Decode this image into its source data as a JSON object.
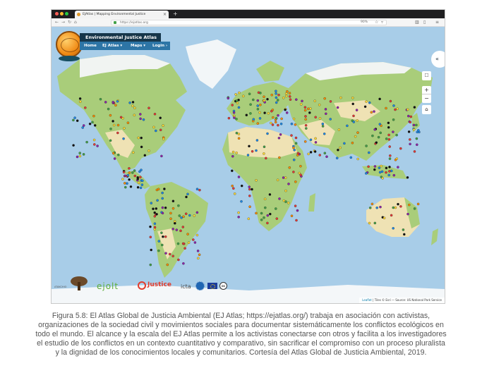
{
  "browser": {
    "tab_title": "EJAtlas | Mapping Environmental Justice",
    "tab_close": "×",
    "new_tab": "+",
    "url": "https://ejatlas.org",
    "zoom": "90%",
    "icons": [
      "back-arrow",
      "forward-arrow",
      "reload",
      "home",
      "lock",
      "star",
      "bookmark",
      "library",
      "sidebar",
      "menu"
    ]
  },
  "site": {
    "title": "Environmental Justice Atlas",
    "nav": [
      {
        "label": "Home"
      },
      {
        "label": "EJ Atlas ▾"
      },
      {
        "label": "Maps ▾"
      },
      {
        "label": "Login ›"
      }
    ]
  },
  "map": {
    "collapse_icon": "«",
    "layers_icon": "☐",
    "zoom_in": "+",
    "zoom_out": "−",
    "home_icon": "⌂",
    "attribution_leaflet": "Leaflet",
    "attribution_rest": " | Tiles © Esri — Source: US National Park Service",
    "colors": {
      "ocean": "#a8cde8",
      "land_green": "#a9cd7a",
      "land_desert": "#efe2b4",
      "ice": "#f4f7f9"
    },
    "marker_colors": [
      "#e53935",
      "#fdd835",
      "#1e88e5",
      "#111111",
      "#43a047",
      "#fb8c00",
      "#8e24aa"
    ]
  },
  "partners": {
    "tree_caption": "ATAKCHIO",
    "ejolt": "ejolt",
    "justice": "Justice",
    "icta": "icta",
    "cc": "cc"
  },
  "caption": "Figura 5.8: El Atlas Global de Justicia Ambiental (EJ Atlas; https://ejatlas.org/) trabaja en asociación con activistas, organizaciones de la sociedad civil y movimientos sociales para documentar sistemáticamente los conflictos ecológicos en todo el mundo. El alcance y la escala del EJ Atlas permite a los activistas conectarse con otros y facilita a los investigadores el estudio de los conflictos en un contexto cuantitativo y comparativo, sin sacrificar el compromiso con un proceso pluralista y la dignidad de los conocimientos locales y comunitarios. Cortesía del Atlas Global de Justicia Ambiental, 2019."
}
